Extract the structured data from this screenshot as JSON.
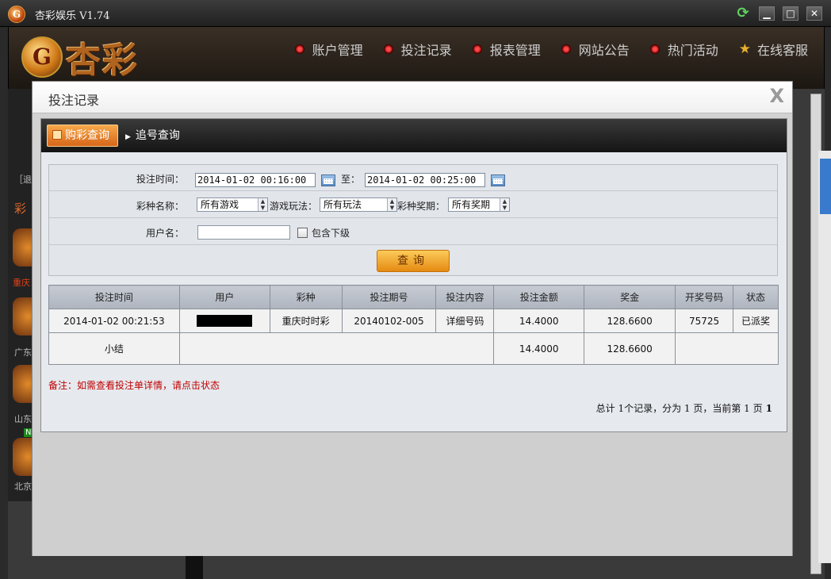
{
  "window": {
    "title": "杏彩娱乐 V1.74",
    "logo_glyph": "G",
    "minimize": "▁",
    "maximize": "□",
    "close": "✕",
    "refresh": "⟳"
  },
  "brand": {
    "coin_glyph": "G",
    "name": "杏彩"
  },
  "nav": {
    "items": [
      {
        "label": "账户管理"
      },
      {
        "label": "投注记录"
      },
      {
        "label": "报表管理"
      },
      {
        "label": "网站公告"
      },
      {
        "label": "热门活动"
      }
    ],
    "service": "在线客服"
  },
  "background": {
    "left_texts": [
      "［退",
      "彩",
      "重庆",
      "广东",
      "山东",
      "北京"
    ],
    "badge": "N"
  },
  "dialog": {
    "title": "投注记录",
    "close": "X"
  },
  "tabs": {
    "active": "购彩查询",
    "inactive": "追号查询"
  },
  "form": {
    "time_label": "投注时间：",
    "time_from": "2014-01-02 00:16:00",
    "to_label": "至：",
    "time_to": "2014-01-02 00:25:00",
    "lottery_label": "彩种名称：",
    "lottery_value": "所有游戏",
    "play_label": "游戏玩法：",
    "play_value": "所有玩法",
    "period_label": "彩种奖期：",
    "period_value": "所有奖期",
    "user_label": "用户名：",
    "user_value": "",
    "include_sub": "包含下级",
    "query_button": "查询"
  },
  "table": {
    "headers": [
      "投注时间",
      "用户",
      "彩种",
      "投注期号",
      "投注内容",
      "投注金额",
      "奖金",
      "开奖号码",
      "状态"
    ],
    "row": {
      "time": "2014-01-02 00:21:53",
      "lottery": "重庆时时彩",
      "period": "20140102-005",
      "content": "详细号码",
      "amount": "14.4000",
      "prize": "128.6600",
      "draw": "75725",
      "status": "已派奖"
    },
    "summary": {
      "label": "小结",
      "amount": "14.4000",
      "prize": "128.6600"
    }
  },
  "note": "备注：如需查看投注单详情，请点击状态",
  "pager": {
    "text": "总计 1个记录，分为 1 页，当前第 1 页",
    "current": "1"
  }
}
